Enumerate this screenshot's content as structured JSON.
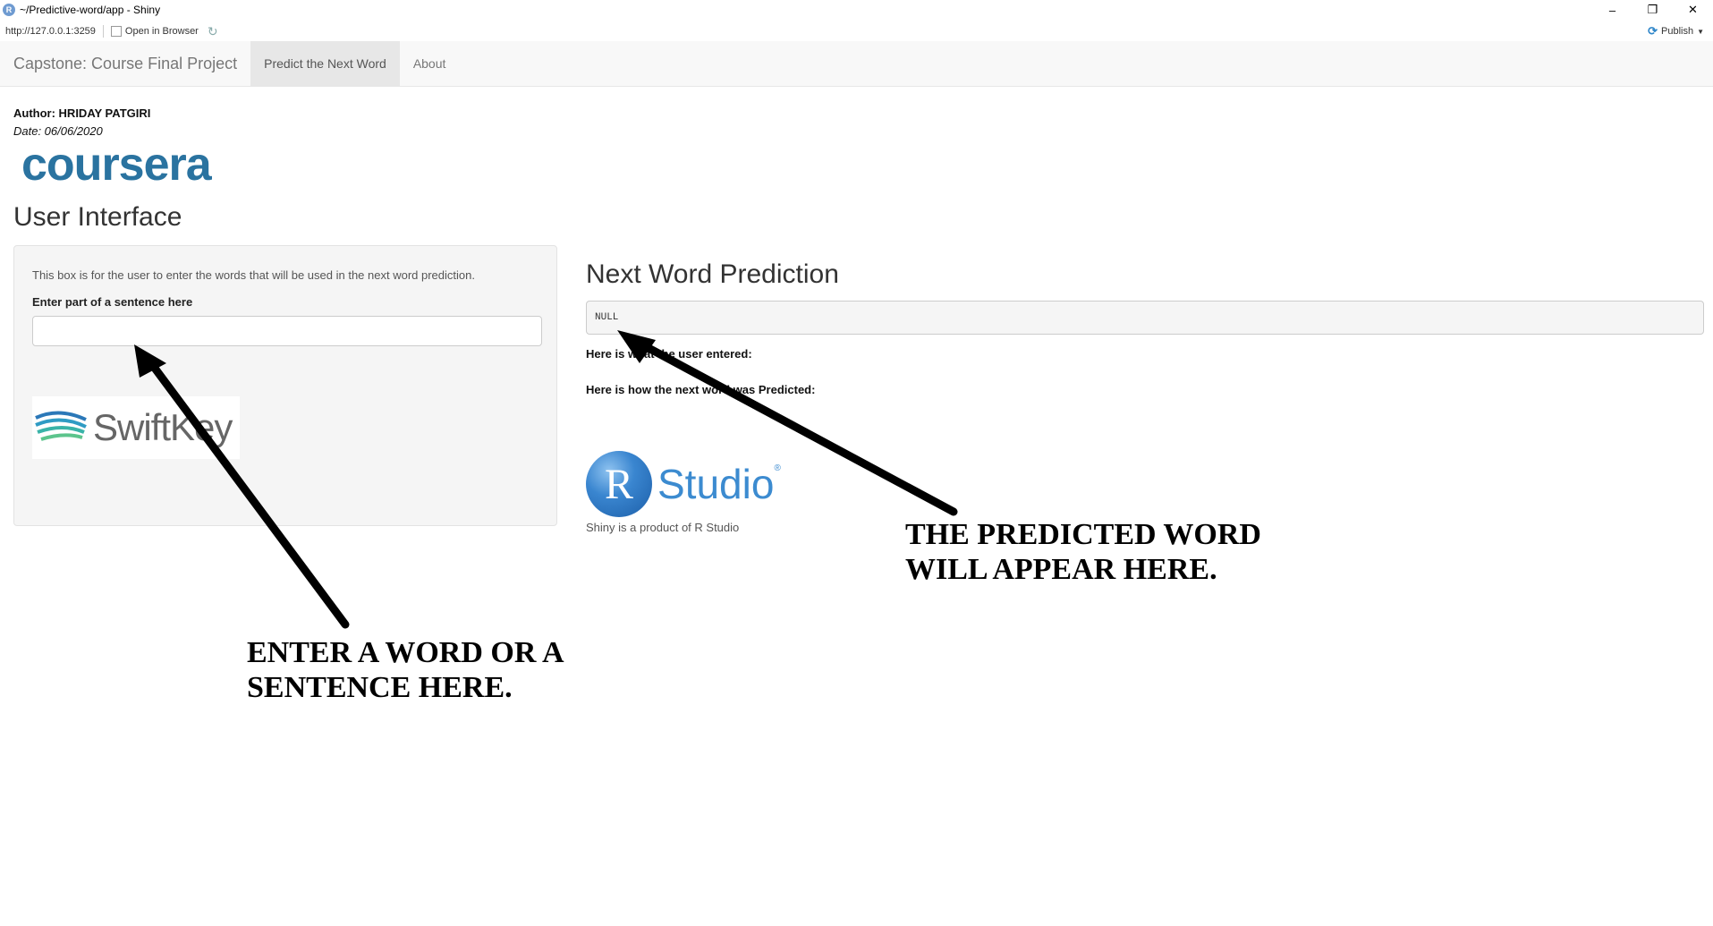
{
  "window": {
    "title": "~/Predictive-word/app - Shiny",
    "r_icon": "R",
    "controls": [
      "–",
      "❐",
      "✕"
    ]
  },
  "urlbar": {
    "url": "http://127.0.0.1:3259",
    "open_browser": "Open in Browser",
    "publish": "Publish"
  },
  "navbar": {
    "brand": "Capstone: Course Final Project",
    "tabs": [
      {
        "label": "Predict the Next Word",
        "active": true
      },
      {
        "label": "About",
        "active": false
      }
    ]
  },
  "header": {
    "author": "Author: HRIDAY PATGIRI",
    "date": "Date: 06/06/2020",
    "logo_text": "coursera"
  },
  "sidebar": {
    "title": "User Interface",
    "description": "This box is for the user to enter the words that will be used in the next word prediction.",
    "input_label": "Enter part of a sentence here",
    "input_value": "",
    "swiftkey_logo": "SwiftKey"
  },
  "main": {
    "title": "Next Word Prediction",
    "output": "NULL",
    "entered_label": "Here is what the user entered:",
    "predicted_label": "Here is how the next word was Predicted:",
    "rstudio_r": "R",
    "rstudio_word": "Studio",
    "rstudio_reg": "®",
    "rstudio_caption": "Shiny is a product of R Studio"
  },
  "annotations": {
    "predicted_line1": "THE PREDICTED WORD",
    "predicted_line2": "WILL APPEAR HERE.",
    "enter_line1": "ENTER A WORD OR A",
    "enter_line2": "SENTENCE HERE."
  }
}
